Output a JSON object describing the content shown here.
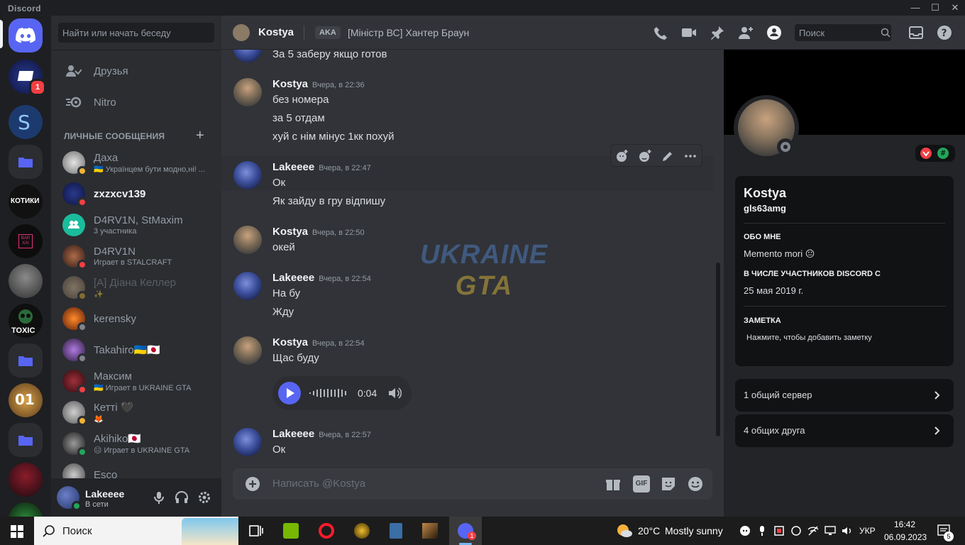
{
  "window": {
    "title": "Discord"
  },
  "servers": {
    "mention_count": "1",
    "icon_texts": [
      "КОТИКИ",
      "TOXIC",
      "BAR XAI"
    ]
  },
  "dm_panel": {
    "search_placeholder": "Найти или начать беседу",
    "nav": [
      {
        "label": "Друзья"
      },
      {
        "label": "Nitro"
      }
    ],
    "header": "ЛИЧНЫЕ СООБЩЕНИЯ",
    "list": [
      {
        "name": "Даха",
        "sub": "🇺🇦 Українцем бути модно,ні! ...",
        "status": "idle"
      },
      {
        "name": "zxzxcv139",
        "sub": "",
        "status": "dnd"
      },
      {
        "name": "D4RV1N, StMaxim",
        "sub": "3 участника",
        "status": ""
      },
      {
        "name": "D4RV1N",
        "sub": "Играет в STALCRAFT",
        "status": "dnd"
      },
      {
        "name": "[A] Діана Келлер",
        "sub": "✨",
        "status": "idle"
      },
      {
        "name": "kerensky",
        "sub": "",
        "status": "offline"
      },
      {
        "name": "Takahiro🇺🇦🇯🇵",
        "sub": "",
        "status": "offline"
      },
      {
        "name": "Максим",
        "sub": "🇺🇦 Играет в UKRAINE GTA",
        "status": "dnd"
      },
      {
        "name": "Кетті 🖤",
        "sub": "🦊",
        "status": "idle"
      },
      {
        "name": "Akihiko🇯🇵",
        "sub": "😑 Играет в UKRAINE GTA",
        "status": "online"
      },
      {
        "name": "Esco",
        "sub": "",
        "status": ""
      }
    ]
  },
  "user": {
    "name": "Lakeeee",
    "status": "В сети"
  },
  "chat": {
    "name": "Kostya",
    "aka": "AKA",
    "nick": "[Міністр ВС] Хантер Браун",
    "search_placeholder": "Поиск",
    "messages": [
      {
        "author": "",
        "time": "",
        "lines": [
          "За 5 заберу якщо готов"
        ]
      },
      {
        "author": "Kostya",
        "time": "Вчера, в 22:36",
        "lines": [
          "без номера",
          "за 5 отдам",
          "хуй с нім мінус 1кк похуй"
        ]
      },
      {
        "author": "Lakeeee",
        "time": "Вчера, в 22:47",
        "lines": [
          "Ок",
          "Як зайду в гру відпишу"
        ]
      },
      {
        "author": "Kostya",
        "time": "Вчера, в 22:50",
        "lines": [
          "окей"
        ]
      },
      {
        "author": "Lakeeee",
        "time": "Вчера, в 22:54",
        "lines": [
          "На бу",
          "Жду"
        ]
      },
      {
        "author": "Kostya",
        "time": "Вчера, в 22:54",
        "lines": [
          "Щас буду"
        ]
      },
      {
        "author": "Lakeeee",
        "time": "Вчера, в 22:57",
        "lines": [
          "Ок"
        ]
      }
    ],
    "voice_duration": "0:04",
    "composer_placeholder": "Написать @Kostya",
    "gif_label": "GIF"
  },
  "watermark": {
    "line1": "UKRAINE",
    "line2": "GTA"
  },
  "profile": {
    "name": "Kostya",
    "username": "gls63amg",
    "about_header": "ОБО МНЕ",
    "about": "Memento mori 😐",
    "member_header": "В ЧИСЛЕ УЧАСТНИКОВ DISCORD С",
    "member_since": "25 мая 2019 г.",
    "note_header": "ЗАМЕТКА",
    "note_placeholder": "Нажмите, чтобы добавить заметку",
    "mutual_servers": "1 общий сервер",
    "mutual_friends": "4 общих друга"
  },
  "taskbar": {
    "search": "Поиск",
    "weather_temp": "20°C",
    "weather_text": "Mostly sunny",
    "lang": "УКР",
    "time": "16:42",
    "date": "06.09.2023",
    "notif_count": "5"
  },
  "colors": {
    "accent": "#5865f2",
    "online": "#23a55a",
    "idle": "#f0b232",
    "dnd": "#f23f43",
    "offline": "#80848e"
  }
}
